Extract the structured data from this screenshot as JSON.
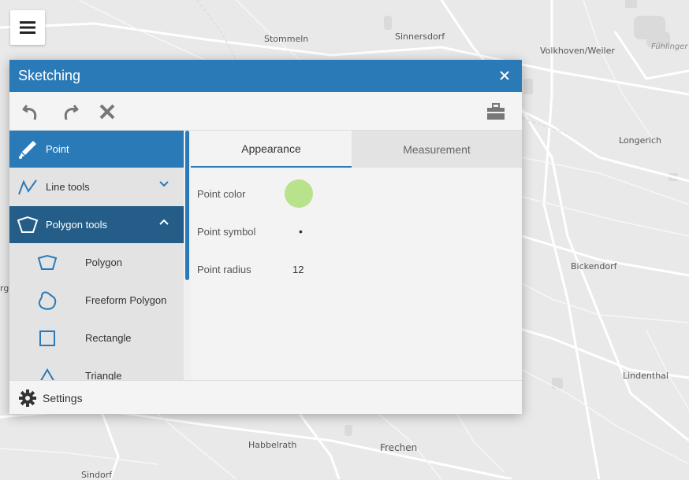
{
  "map": {
    "labels": [
      "Stommeln",
      "Sinnersdorf",
      "Volkhoven/Weiler",
      "Fühlinger See",
      "Longerich",
      "Bickendorf",
      "Lindenthal",
      "Habbelrath",
      "Frechen",
      "Sindorf",
      "rg"
    ]
  },
  "menu": {
    "icon": "hamburger-menu-icon"
  },
  "panel": {
    "title": "Sketching",
    "close_icon": "close-icon",
    "toolbar": {
      "undo_icon": "undo-icon",
      "redo_icon": "redo-icon",
      "delete_icon": "delete-icon",
      "toolbox_icon": "toolbox-icon"
    },
    "sidebar": {
      "point": {
        "label": "Point",
        "icon": "pen-icon"
      },
      "line_tools": {
        "label": "Line tools",
        "icon": "polyline-icon"
      },
      "polygon_tools": {
        "label": "Polygon tools",
        "icon": "polygon-icon"
      },
      "polygon": {
        "label": "Polygon",
        "icon": "polygon-icon"
      },
      "freeform_polygon": {
        "label": "Freeform Polygon",
        "icon": "freeform-polygon-icon"
      },
      "rectangle": {
        "label": "Rectangle",
        "icon": "rectangle-icon"
      },
      "triangle": {
        "label": "Triangle",
        "icon": "triangle-icon"
      }
    },
    "tabs": {
      "appearance": "Appearance",
      "measurement": "Measurement"
    },
    "properties": {
      "color_label": "Point color",
      "color_value": "#b9e28c",
      "symbol_label": "Point symbol",
      "symbol_value": "•",
      "radius_label": "Point radius",
      "radius_value": "12"
    },
    "settings": {
      "label": "Settings",
      "icon": "gear-icon"
    }
  },
  "colors": {
    "accent": "#2a7ab8",
    "accent_dark": "#245d87"
  }
}
